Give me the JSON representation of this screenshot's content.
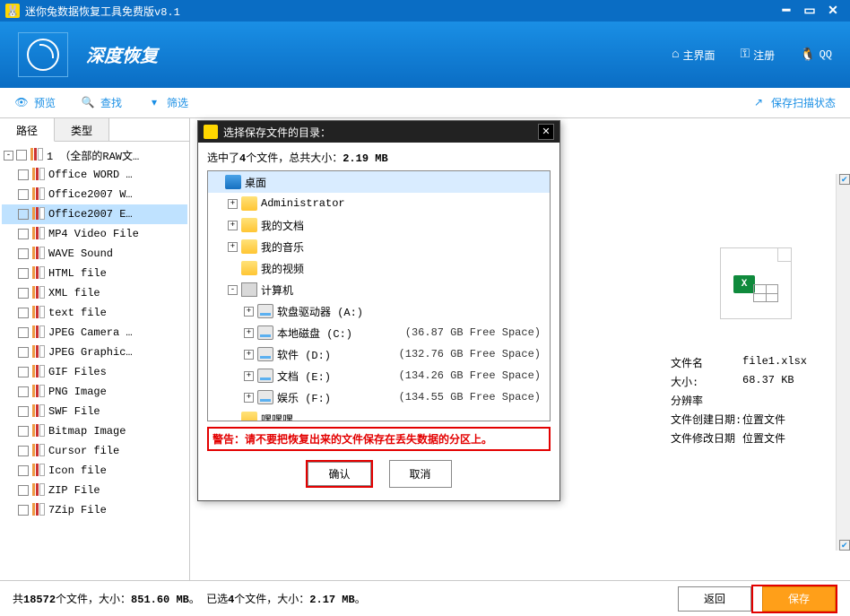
{
  "app": {
    "title": "迷你兔数据恢复工具免费版v8.1"
  },
  "header": {
    "mode": "深度恢复",
    "nav": {
      "home": "主界面",
      "register": "注册",
      "qq": "QQ"
    }
  },
  "toolbar": {
    "preview": "预览",
    "find": "查找",
    "filter": "筛选",
    "save_state": "保存扫描状态"
  },
  "tabs": {
    "path": "路径",
    "type": "类型"
  },
  "tree": {
    "root": "1 （全部的RAW文…",
    "items": [
      "Office WORD …",
      "Office2007 W…",
      "Office2007 E…",
      "MP4 Video File",
      "WAVE Sound",
      "HTML file",
      "XML file",
      "text file",
      "JPEG Camera …",
      "JPEG Graphic…",
      "GIF Files",
      "PNG Image",
      "SWF File",
      "Bitmap Image",
      "Cursor file",
      "Icon file",
      "ZIP File",
      "7Zip File"
    ],
    "selected_index": 2
  },
  "detail": {
    "rows": [
      {
        "label": "文件名",
        "value": "file1.xlsx"
      },
      {
        "label": "大小:",
        "value": "68.37 KB"
      },
      {
        "label": "分辨率",
        "value": ""
      },
      {
        "label": "文件创建日期:",
        "value": "位置文件"
      },
      {
        "label": "文件修改日期",
        "value": "位置文件"
      }
    ]
  },
  "status": {
    "text_a": "共",
    "total_files": "18572",
    "text_b": "个文件，大小：",
    "total_size": "851.60 MB",
    "dot": "。  ",
    "text_c": "已选",
    "sel_files": "4",
    "text_d": "个文件，大小：",
    "sel_size": "2.17 MB",
    "dot2": "。",
    "back": "返回",
    "save": "保存"
  },
  "dialog": {
    "title": "选择保存文件的目录：",
    "info_a": "选中了",
    "info_count": "4",
    "info_b": "个文件，总共大小：",
    "info_size": "2.19 MB",
    "desktop": "桌面",
    "nodes": [
      {
        "indent": 1,
        "expand": "+",
        "icon": "folder",
        "label": "Administrator"
      },
      {
        "indent": 1,
        "expand": "+",
        "icon": "folder",
        "label": "我的文档"
      },
      {
        "indent": 1,
        "expand": "+",
        "icon": "folder",
        "label": "我的音乐"
      },
      {
        "indent": 1,
        "expand": " ",
        "icon": "folder",
        "label": "我的视频"
      },
      {
        "indent": 1,
        "expand": "-",
        "icon": "computer",
        "label": "计算机"
      },
      {
        "indent": 2,
        "expand": "+",
        "icon": "drive",
        "label": "软盘驱动器 (A:)",
        "free": ""
      },
      {
        "indent": 2,
        "expand": "+",
        "icon": "drive",
        "label": "本地磁盘 (C:)",
        "free": "(36.87 GB Free Space)"
      },
      {
        "indent": 2,
        "expand": "+",
        "icon": "drive",
        "label": "软件 (D:)",
        "free": "(132.76 GB Free Space)"
      },
      {
        "indent": 2,
        "expand": "+",
        "icon": "drive",
        "label": "文档 (E:)",
        "free": "(134.26 GB Free Space)"
      },
      {
        "indent": 2,
        "expand": "+",
        "icon": "drive",
        "label": "娱乐 (F:)",
        "free": "(134.55 GB Free Space)"
      },
      {
        "indent": 1,
        "expand": " ",
        "icon": "folder",
        "label": "嘿嘿嘿"
      }
    ],
    "warn_prefix": "警告：",
    "warn_text": "请不要把恢复出来的文件保存在丢失数据的分区上。",
    "ok": "确认",
    "cancel": "取消"
  }
}
